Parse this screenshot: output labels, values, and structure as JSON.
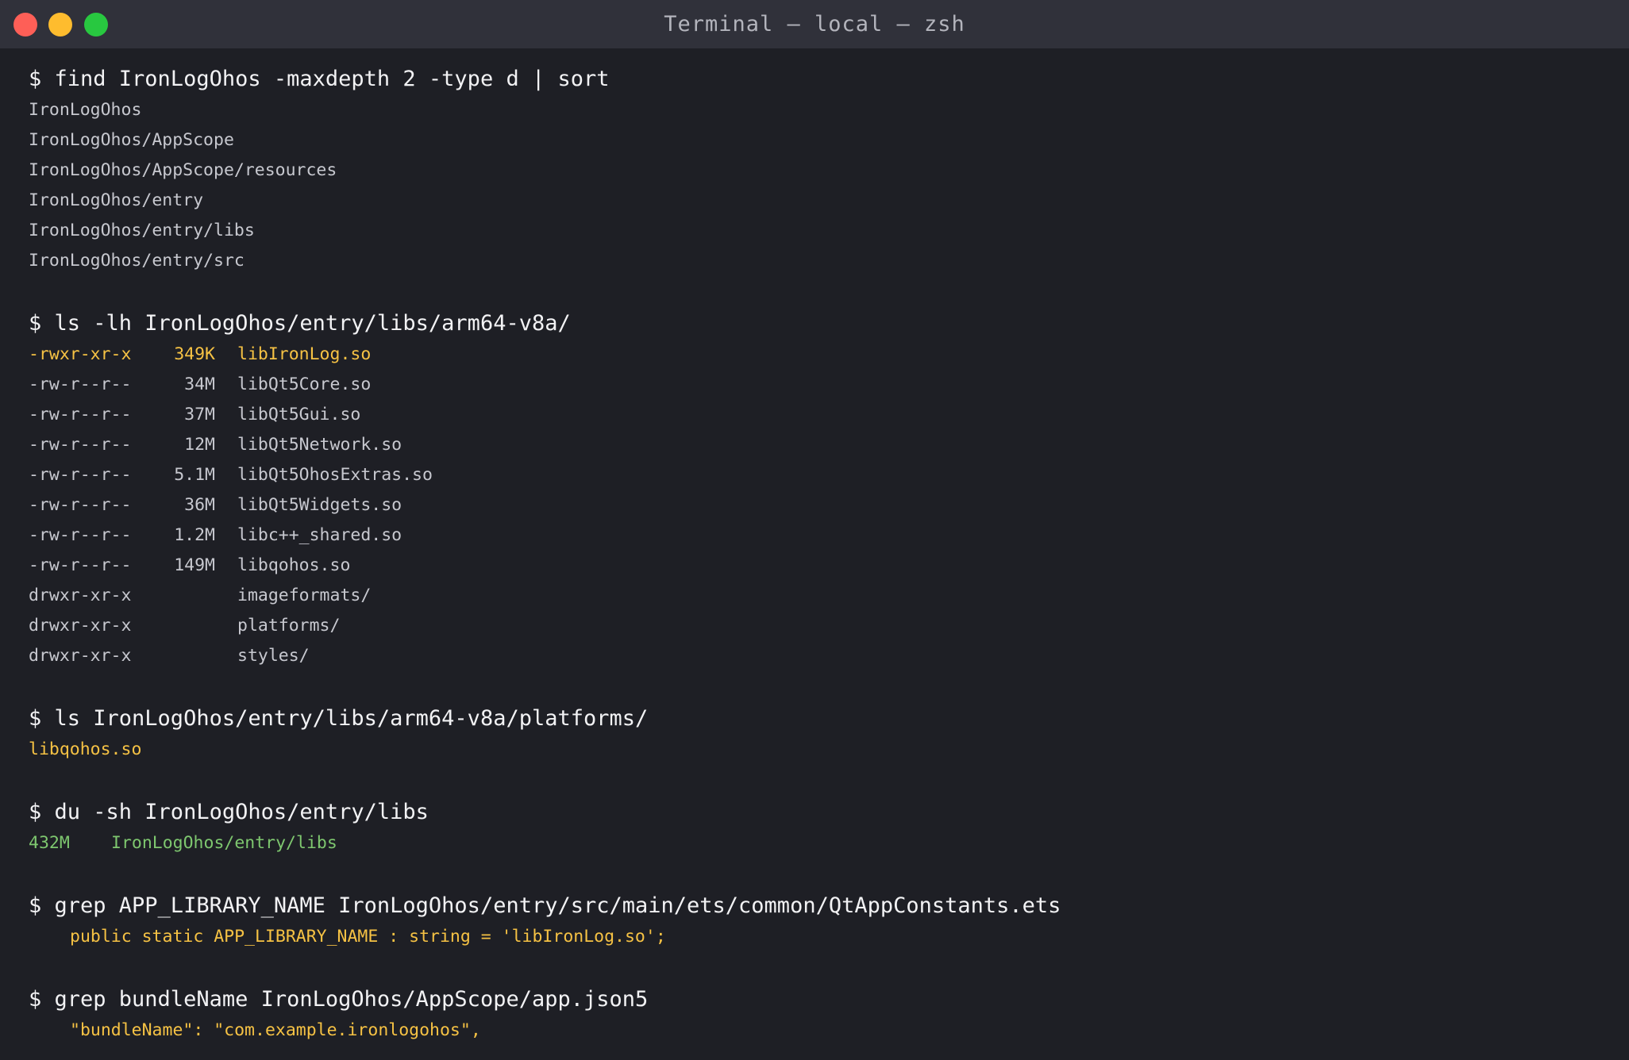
{
  "window": {
    "title": "Terminal — local — zsh"
  },
  "blocks": {
    "find": {
      "command": "$ find IronLogOhos -maxdepth 2 -type d | sort",
      "output": [
        "IronLogOhos",
        "IronLogOhos/AppScope",
        "IronLogOhos/AppScope/resources",
        "IronLogOhos/entry",
        "IronLogOhos/entry/libs",
        "IronLogOhos/entry/src"
      ]
    },
    "ls_libs": {
      "command": "$ ls -lh IronLogOhos/entry/libs/arm64-v8a/",
      "rows": [
        {
          "perm": "-rwxr-xr-x",
          "size": "349K",
          "name": "libIronLog.so"
        },
        {
          "perm": "-rw-r--r--",
          "size": "34M",
          "name": "libQt5Core.so"
        },
        {
          "perm": "-rw-r--r--",
          "size": "37M",
          "name": "libQt5Gui.so"
        },
        {
          "perm": "-rw-r--r--",
          "size": "12M",
          "name": "libQt5Network.so"
        },
        {
          "perm": "-rw-r--r--",
          "size": "5.1M",
          "name": "libQt5OhosExtras.so"
        },
        {
          "perm": "-rw-r--r--",
          "size": "36M",
          "name": "libQt5Widgets.so"
        },
        {
          "perm": "-rw-r--r--",
          "size": "1.2M",
          "name": "libc++_shared.so"
        },
        {
          "perm": "-rw-r--r--",
          "size": "149M",
          "name": "libqohos.so"
        },
        {
          "perm": "drwxr-xr-x",
          "size": "",
          "name": "imageformats/"
        },
        {
          "perm": "drwxr-xr-x",
          "size": "",
          "name": "platforms/"
        },
        {
          "perm": "drwxr-xr-x",
          "size": "",
          "name": "styles/"
        }
      ]
    },
    "ls_platforms": {
      "command": "$ ls IronLogOhos/entry/libs/arm64-v8a/platforms/",
      "output": "libqohos.so"
    },
    "du": {
      "command": "$ du -sh IronLogOhos/entry/libs",
      "size": "432M",
      "path": "IronLogOhos/entry/libs"
    },
    "grep_lib": {
      "command": "$ grep APP_LIBRARY_NAME IronLogOhos/entry/src/main/ets/common/QtAppConstants.ets",
      "output": "public static APP_LIBRARY_NAME : string = 'libIronLog.so';"
    },
    "grep_bundle": {
      "command": "$ grep bundleName IronLogOhos/AppScope/app.json5",
      "output": "\"bundleName\": \"com.example.ironlogohos\","
    }
  },
  "colors": {
    "background": "#1e1f25",
    "titlebar": "#30313a",
    "highlight": "#f6c244",
    "green": "#7ec76f",
    "close": "#fe5f57",
    "minimize": "#febc2e",
    "zoom": "#28c840"
  }
}
